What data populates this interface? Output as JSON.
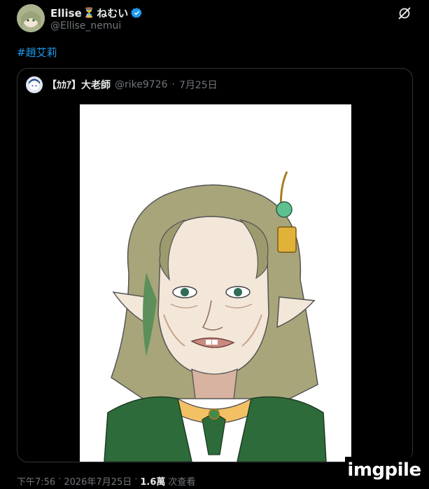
{
  "author": {
    "name": "Ellise",
    "name_emoji": "⏳",
    "name_suffix": "ねむい",
    "handle": "@Ellise_nemui"
  },
  "tweet": {
    "hashtag": "#趙艾莉"
  },
  "quote": {
    "author_name": "【ｶｶｱ】大老師",
    "author_handle": "@rike9726",
    "separator": "·",
    "date": "7月25日"
  },
  "footer": {
    "time": "下午7:56",
    "sep1": "·",
    "date": "2026年7月25日",
    "sep2": "·",
    "views_count": "1.6萬",
    "views_label": "次查看"
  },
  "watermark": {
    "text": "imgpile"
  },
  "colors": {
    "background": "#000000",
    "text_primary": "#e7e9ea",
    "text_secondary": "#71767b",
    "link": "#1d9bf0",
    "verified": "#1d9bf0",
    "border": "#2f3336"
  },
  "icons": {
    "verified": "verified-badge-icon",
    "grok": "grok-icon"
  }
}
